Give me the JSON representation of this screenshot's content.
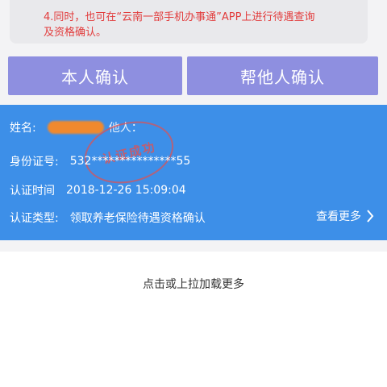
{
  "notice": {
    "line1": "4.同时，也可在“云南一部手机办事通”APP上进行待遇查询",
    "line2": "及资格确认。"
  },
  "buttons": {
    "self_confirm": "本人确认",
    "help_other_confirm": "帮他人确认"
  },
  "record": {
    "name_label": "姓名:",
    "name_tail": "他人：",
    "id_label": "身份证号:",
    "id_value": "532***************55",
    "time_label": "认证时间",
    "time_value": "2018-12-26 15:09:04",
    "type_label": "认证类型:",
    "type_value": "领取养老保险待遇资格确认",
    "more_label": "查看更多",
    "stamp_text": "认证成功"
  },
  "footer": {
    "load_more": "点击或上拉加载更多"
  },
  "colors": {
    "notice_text": "#e23c3c",
    "button_bg": "#8e8fe0",
    "card_bg": "#3d8fe8"
  }
}
